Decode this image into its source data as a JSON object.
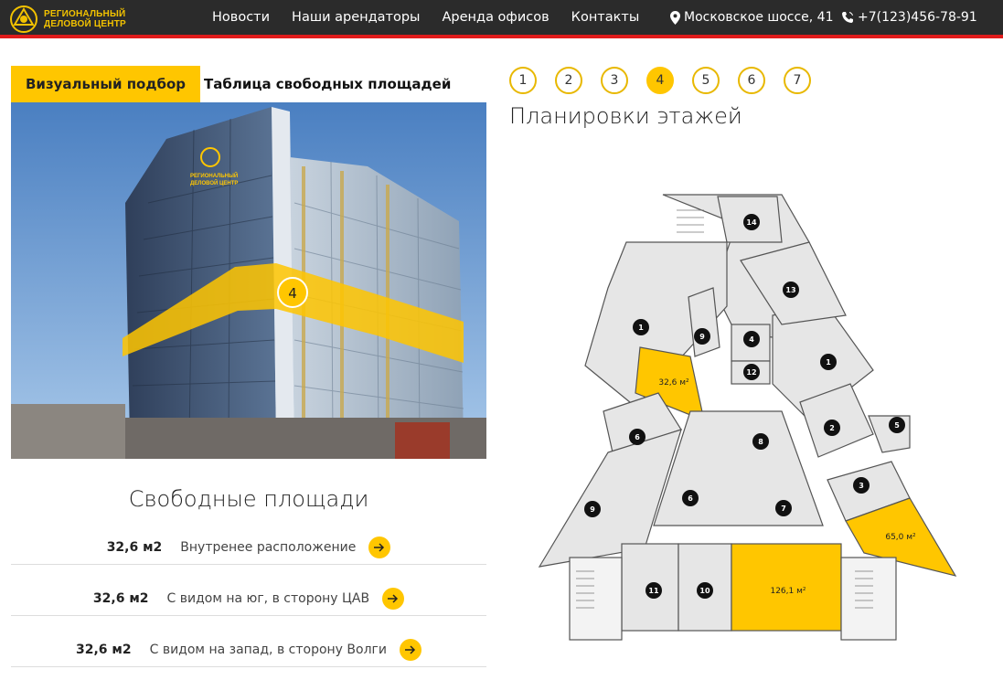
{
  "header": {
    "logo_line1": "РЕГИОНАЛЬНЫЙ",
    "logo_line2": "ДЕЛОВОЙ ЦЕНТР",
    "nav": [
      "Новости",
      "Наши арендаторы",
      "Аренда офисов",
      "Контакты"
    ],
    "address": "Московское шоссе, 41",
    "phone": "+7(123)456-78-91"
  },
  "tabs": {
    "visual": "Визуальный подбор",
    "table": "Таблица свободных площадей"
  },
  "photo": {
    "sign_line1": "РЕГИОНАЛЬНЫЙ",
    "sign_line2": "ДЕЛОВОЙ ЦЕНТР",
    "selected_floor_marker": "4"
  },
  "free_areas": {
    "title": "Свободные площади",
    "items": [
      {
        "area": "32,6 м2",
        "desc": "Внутренее расположение"
      },
      {
        "area": "32,6 м2",
        "desc": "С видом на юг, в сторону ЦАВ"
      },
      {
        "area": "32,6 м2",
        "desc": "С видом на запад, в сторону Волги"
      }
    ]
  },
  "floors": {
    "items": [
      "1",
      "2",
      "3",
      "4",
      "5",
      "6",
      "7"
    ],
    "active": "4"
  },
  "plan": {
    "title": "Планировки этажей",
    "room_numbers": [
      "14",
      "13",
      "1",
      "9",
      "4",
      "12",
      "1",
      "2",
      "5",
      "6",
      "8",
      "6",
      "7",
      "3",
      "9",
      "11",
      "10"
    ],
    "available": [
      "32,6 м²",
      "65,0 м²",
      "126,1 м²"
    ]
  },
  "colors": {
    "accent": "#ffc600",
    "header_bg": "#2b2b2b",
    "header_line": "#e01b1b",
    "room_fill": "#e6e6e6"
  }
}
